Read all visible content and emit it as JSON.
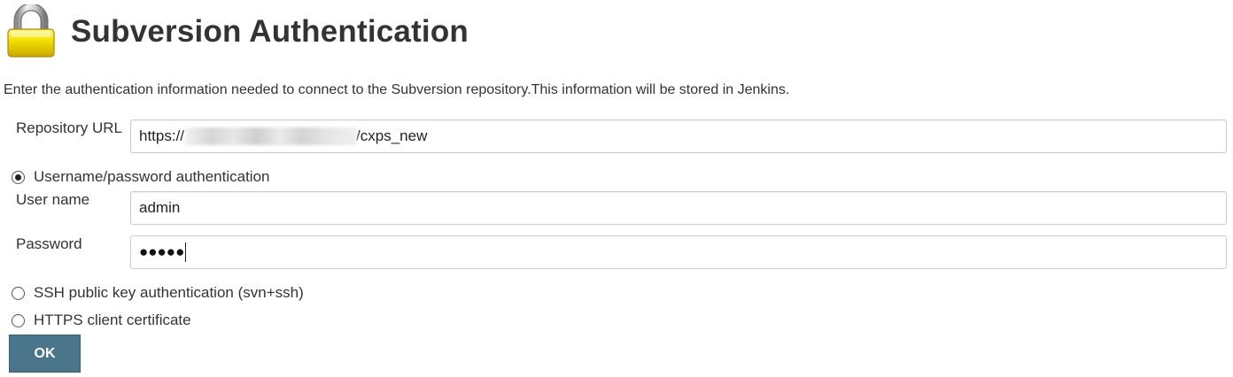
{
  "window": {
    "title": "Subversion Authentication"
  },
  "icons": {
    "header_icon": "padlock-icon"
  },
  "intro_text": "Enter the authentication information needed to connect to the Subversion repository.This information will be stored in Jenkins.",
  "repository": {
    "label": "Repository URL",
    "value_prefix": "https://",
    "value_suffix": "/cxps_new"
  },
  "auth_options": [
    {
      "label": "Username/password authentication",
      "selected": true
    },
    {
      "label": "SSH public key authentication (svn+ssh)",
      "selected": false
    },
    {
      "label": "HTTPS client certificate",
      "selected": false
    }
  ],
  "credentials": {
    "username_label": "User name",
    "username_value": "admin",
    "password_label": "Password",
    "password_masked": "●●●●●"
  },
  "ok_button": {
    "label": "OK"
  },
  "colors": {
    "button_bg": "#4b758b",
    "text": "#333333",
    "lock_body": "#f5e400",
    "lock_shackle": "#bdbdbd"
  }
}
